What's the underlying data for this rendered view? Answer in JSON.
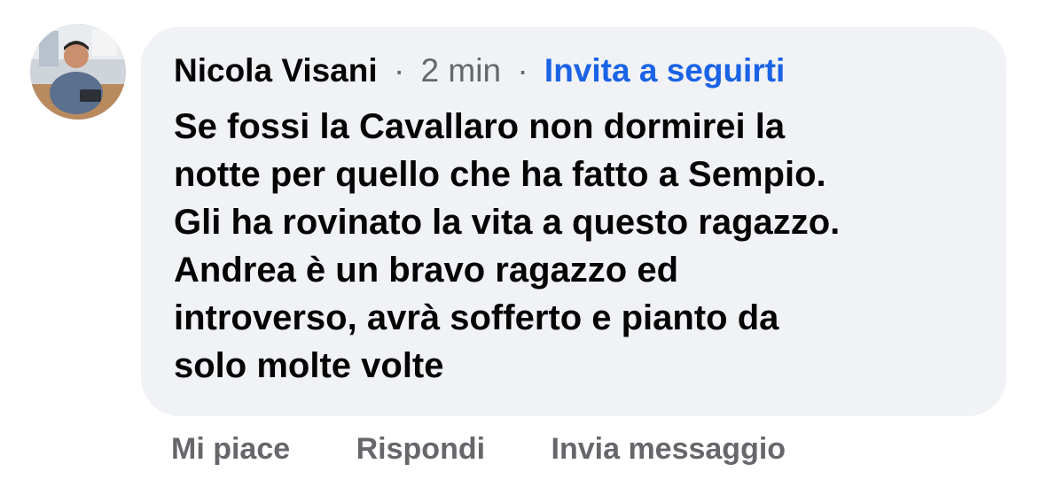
{
  "comment": {
    "author": "Nicola Visani",
    "separator": "·",
    "time": "2 min",
    "follow_label": "Invita a seguirti",
    "text_lines": [
      "Se fossi la Cavallaro non dormirei la",
      "notte per quello che ha fatto a Sempio.",
      "Gli ha rovinato la vita a questo ragazzo.",
      "Andrea è un bravo ragazzo ed",
      "introverso, avrà sofferto e pianto da",
      "solo molte volte"
    ]
  },
  "actions": {
    "like_label": "Mi piace",
    "reply_label": "Rispondi",
    "message_label": "Invia messaggio"
  },
  "colors": {
    "bubble_bg": "#f0f2f5",
    "text": "#050505",
    "secondary": "#65676b",
    "link": "#1a63e6"
  }
}
